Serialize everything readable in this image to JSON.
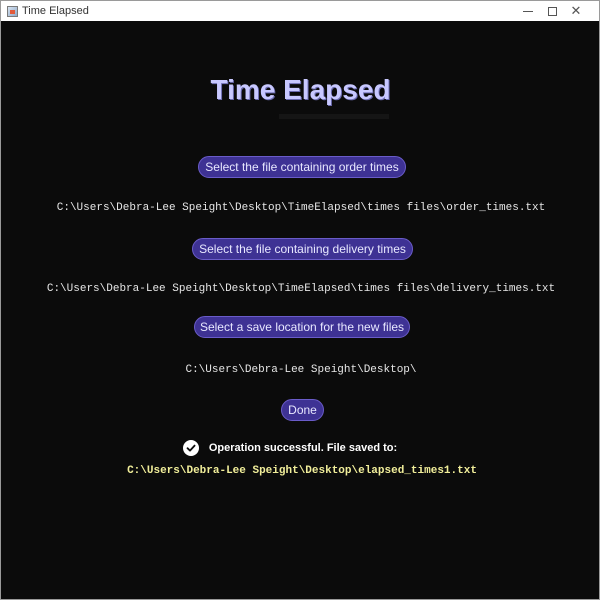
{
  "window": {
    "title": "Time Elapsed"
  },
  "main": {
    "heading": "Time Elapsed",
    "order_button_label": "Select the file containing order times",
    "order_path": "C:\\Users\\Debra-Lee Speight\\Desktop\\TimeElapsed\\times files\\order_times.txt",
    "delivery_button_label": "Select the file containing delivery times",
    "delivery_path": "C:\\Users\\Debra-Lee Speight\\Desktop\\TimeElapsed\\times files\\delivery_times.txt",
    "save_button_label": "Select a save location for the new files",
    "save_path": "C:\\Users\\Debra-Lee Speight\\Desktop\\",
    "done_button_label": "Done"
  },
  "status": {
    "icon": "check-circle-icon",
    "message": "Operation successful. File saved to:",
    "saved_file": "C:\\Users\\Debra-Lee Speight\\Desktop\\elapsed_times1.txt"
  },
  "colors": {
    "background": "#0b0b0b",
    "heading": "#c8c8ff",
    "button": "#3e3294",
    "saved_path": "#f1ee9a"
  }
}
